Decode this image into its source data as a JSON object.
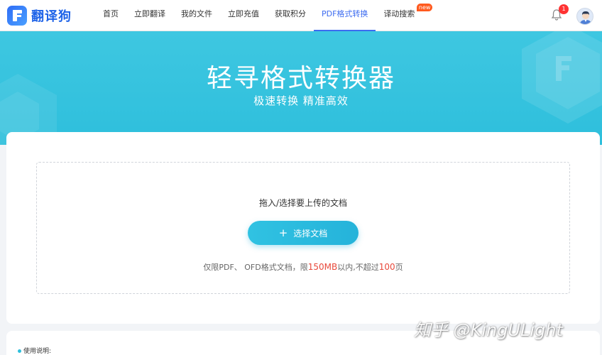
{
  "brand": {
    "name": "翻译狗"
  },
  "nav": {
    "items": [
      {
        "label": "首页",
        "active": false
      },
      {
        "label": "立即翻译",
        "active": false
      },
      {
        "label": "我的文件",
        "active": false
      },
      {
        "label": "立即充值",
        "active": false
      },
      {
        "label": "获取积分",
        "active": false
      },
      {
        "label": "PDF格式转换",
        "active": true
      },
      {
        "label": "译动搜索",
        "active": false,
        "badge": "new"
      }
    ]
  },
  "notifications": {
    "icon": "bell-icon",
    "count": "1"
  },
  "banner": {
    "title": "轻寻格式转换器",
    "subtitle": "极速转换 精准高效"
  },
  "upload": {
    "hint": "拖入/选择要上传的文档",
    "button_label": "选择文档",
    "limit_prefix": "仅限PDF、 OFD格式文档，限",
    "limit_size": "150MB",
    "limit_middle": "以内,不超过",
    "limit_pages": "100",
    "limit_suffix": "页"
  },
  "usage": {
    "label": "使用说明:"
  },
  "watermark": "知乎 @KingULight",
  "colors": {
    "accent": "#2ebfdc",
    "nav_active": "#3d6cf0",
    "highlight": "#e8493b",
    "badge": "#ff5a1f"
  }
}
